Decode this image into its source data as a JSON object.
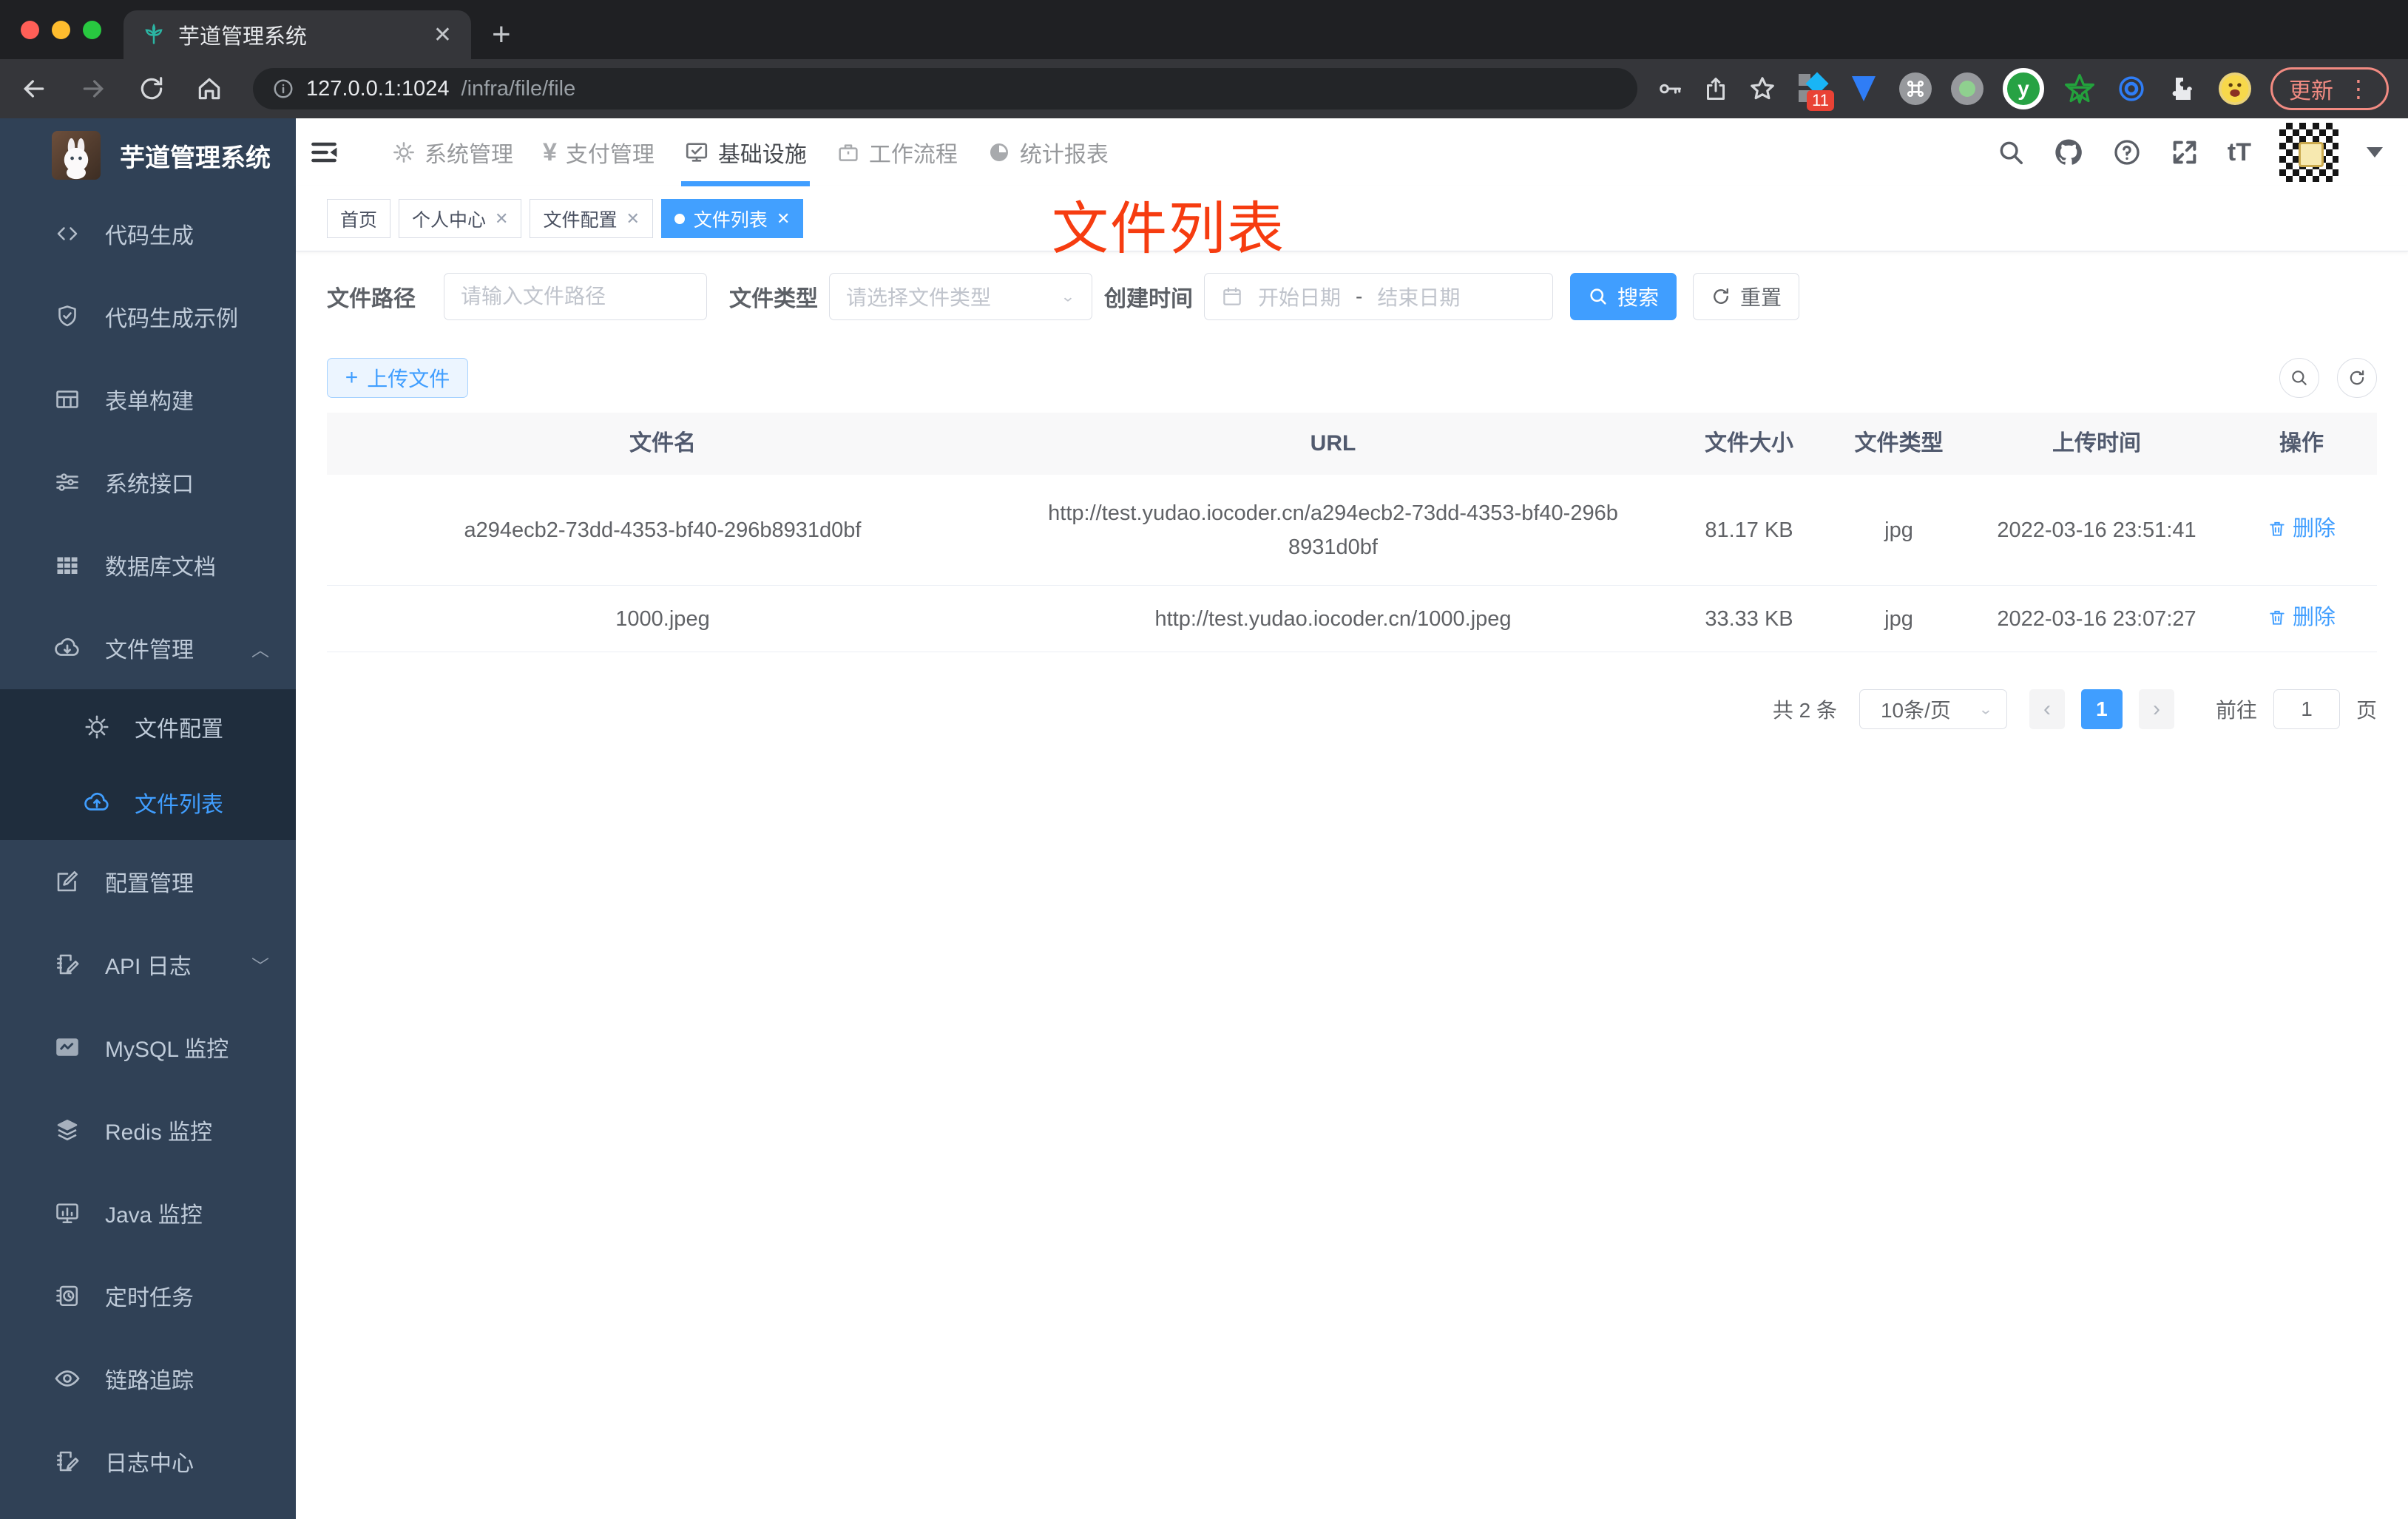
{
  "browser": {
    "tab_title": "芋道管理系统",
    "url_host": "127.0.0.1:1024",
    "url_path": "/infra/file/file",
    "extension_badge": "11",
    "extension_y": "y",
    "update_button": "更新"
  },
  "sidebar": {
    "logo_title": "芋道管理系统",
    "items": [
      {
        "label": "代码生成"
      },
      {
        "label": "代码生成示例"
      },
      {
        "label": "表单构建"
      },
      {
        "label": "系统接口"
      },
      {
        "label": "数据库文档"
      },
      {
        "label": "文件管理"
      },
      {
        "label": "配置管理"
      },
      {
        "label": "API 日志"
      },
      {
        "label": "MySQL 监控"
      },
      {
        "label": "Redis 监控"
      },
      {
        "label": "Java 监控"
      },
      {
        "label": "定时任务"
      },
      {
        "label": "链路追踪"
      },
      {
        "label": "日志中心"
      }
    ],
    "file_submenu": [
      {
        "label": "文件配置"
      },
      {
        "label": "文件列表"
      }
    ]
  },
  "topnav": {
    "menus": [
      {
        "label": "系统管理"
      },
      {
        "label": "支付管理"
      },
      {
        "label": "基础设施"
      },
      {
        "label": "工作流程"
      },
      {
        "label": "统计报表"
      }
    ],
    "font_size_icon": "tT"
  },
  "tags": [
    {
      "label": "首页"
    },
    {
      "label": "个人中心"
    },
    {
      "label": "文件配置"
    },
    {
      "label": "文件列表"
    }
  ],
  "annotation": "文件列表",
  "filters": {
    "path_label": "文件路径",
    "path_placeholder": "请输入文件路径",
    "type_label": "文件类型",
    "type_placeholder": "请选择文件类型",
    "date_label": "创建时间",
    "date_start_placeholder": "开始日期",
    "date_separator": "-",
    "date_end_placeholder": "结束日期",
    "search_button": "搜索",
    "reset_button": "重置"
  },
  "toolbar": {
    "upload_button": "上传文件"
  },
  "table": {
    "headers": [
      "文件名",
      "URL",
      "文件大小",
      "文件类型",
      "上传时间",
      "操作"
    ],
    "rows": [
      {
        "name": "a294ecb2-73dd-4353-bf40-296b8931d0bf",
        "url": "http://test.yudao.iocoder.cn/a294ecb2-73dd-4353-bf40-296b8931d0bf",
        "size": "81.17 KB",
        "type": "jpg",
        "time": "2022-03-16 23:51:41",
        "action": "删除"
      },
      {
        "name": "1000.jpeg",
        "url": "http://test.yudao.iocoder.cn/1000.jpeg",
        "size": "33.33 KB",
        "type": "jpg",
        "time": "2022-03-16 23:07:27",
        "action": "删除"
      }
    ]
  },
  "pagination": {
    "total": "共 2 条",
    "page_size": "10条/页",
    "current_page": "1",
    "goto_label": "前往",
    "goto_value": "1",
    "page_unit": "页"
  },
  "colors": {
    "accent": "#409EFF",
    "annotation_red": "#F63C10",
    "sidebar_bg": "#304156",
    "submenu_bg": "#1F2D3D",
    "tag_active": "#42A0FF"
  }
}
